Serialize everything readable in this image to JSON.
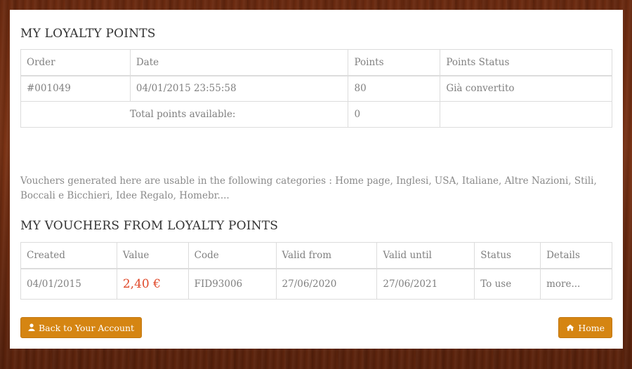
{
  "loyalty": {
    "title": "MY LOYALTY POINTS",
    "headers": [
      "Order",
      "Date",
      "Points",
      "Points Status"
    ],
    "rows": [
      {
        "order": "#001049",
        "date": "04/01/2015 23:55:58",
        "points": "80",
        "status": "Già convertito"
      }
    ],
    "total_label": "Total points available:",
    "total_value": "0"
  },
  "info_text": "Vouchers generated here are usable in the following categories : Home page, Inglesi, USA, Italiane, Altre Nazioni, Stili, Boccali e Bicchieri, Idee Regalo, Homebr....",
  "vouchers": {
    "title": "MY VOUCHERS FROM LOYALTY POINTS",
    "headers": [
      "Created",
      "Value",
      "Code",
      "Valid from",
      "Valid until",
      "Status",
      "Details"
    ],
    "rows": [
      {
        "created": "04/01/2015",
        "value": "2,40 €",
        "code": "FID93006",
        "valid_from": "27/06/2020",
        "valid_until": "27/06/2021",
        "status": "To use",
        "details": "more..."
      }
    ]
  },
  "buttons": {
    "back_label": "Back to Your Account",
    "home_label": "Home"
  },
  "colors": {
    "accent": "#d58512",
    "price": "#e0492a"
  },
  "icons": {
    "back": "user-icon",
    "home": "home-icon"
  }
}
